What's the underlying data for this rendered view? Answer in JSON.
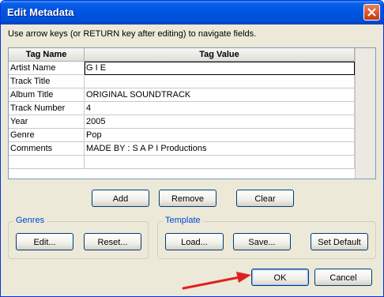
{
  "window": {
    "title": "Edit Metadata"
  },
  "instructions": "Use arrow keys (or RETURN key after editing) to navigate fields.",
  "table": {
    "headers": [
      "Tag Name",
      "Tag Value"
    ],
    "rows": [
      {
        "name": "Artist Name",
        "value": "G I E"
      },
      {
        "name": "Track Title",
        "value": ""
      },
      {
        "name": "Album Title",
        "value": "ORIGINAL SOUNDTRACK"
      },
      {
        "name": "Track Number",
        "value": "4"
      },
      {
        "name": "Year",
        "value": "2005"
      },
      {
        "name": "Genre",
        "value": "Pop"
      },
      {
        "name": "Comments",
        "value": "MADE BY : S A P I Productions"
      }
    ]
  },
  "buttons": {
    "add": "Add",
    "remove": "Remove",
    "clear": "Clear",
    "ok": "OK",
    "cancel": "Cancel"
  },
  "genres": {
    "label": "Genres",
    "edit": "Edit...",
    "reset": "Reset..."
  },
  "template": {
    "label": "Template",
    "load": "Load...",
    "save": "Save...",
    "set_default": "Set Default"
  },
  "icons": {
    "close": "close-icon",
    "arrow": "red-arrow-annotation"
  },
  "colors": {
    "titlebar": "#0054e3",
    "group_label": "#0046d5",
    "arrow": "#e02020"
  }
}
